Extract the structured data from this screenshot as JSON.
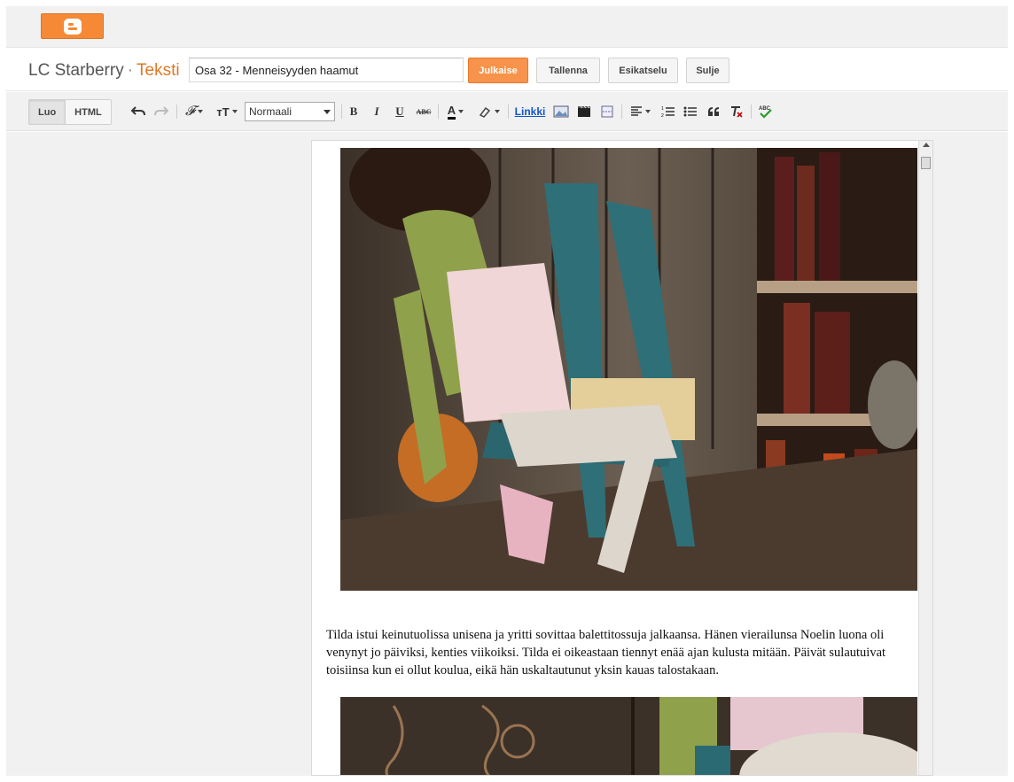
{
  "blog": {
    "name": "LC Starberry",
    "separator": "·",
    "section": "Teksti"
  },
  "post": {
    "title": "Osa 32 - Menneisyyden haamut"
  },
  "actions": {
    "publish": "Julkaise",
    "save": "Tallenna",
    "preview": "Esikatselu",
    "close": "Sulje"
  },
  "modes": {
    "compose": "Luo",
    "html": "HTML"
  },
  "toolbar": {
    "font_glyph": "𝓕",
    "size_glyph": "тT",
    "format_value": "Normaali",
    "bold": "B",
    "italic": "I",
    "underline": "U",
    "strike": "ABC",
    "text_color": "A",
    "link": "Linkki"
  },
  "content": {
    "paragraph": "Tilda istui keinutuolissa unisena ja yritti sovittaa balettitossuja jalkaansa. Hänen vierailunsa Noelin luona oli venynyt jo päiviksi, kenties viikoiksi. Tilda ei oikeastaan tiennyt enää ajan kulusta mitään. Päivät sulautuivat toisiinsa kun ei ollut koulua, eikä hän uskaltautunut yksin kauas talostakaan."
  },
  "colors": {
    "brand": "#f58936",
    "section_title": "#dd7826",
    "link": "#1155cc"
  }
}
